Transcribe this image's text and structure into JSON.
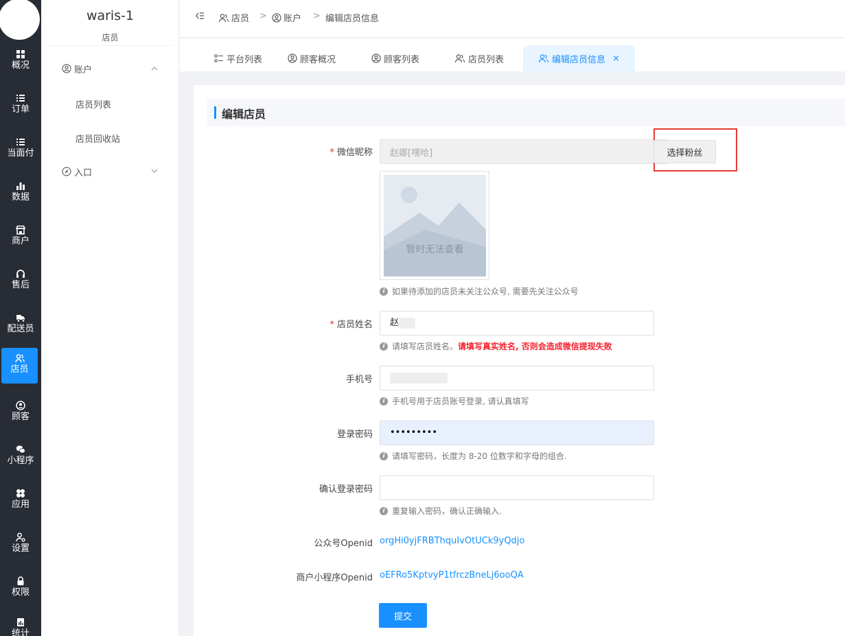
{
  "nav": {
    "items": [
      {
        "key": "overview",
        "label": "概况",
        "icon": "grid-icon"
      },
      {
        "key": "orders",
        "label": "订单",
        "icon": "list-icon"
      },
      {
        "key": "facepay",
        "label": "当面付",
        "icon": "list-icon"
      },
      {
        "key": "data",
        "label": "数据",
        "icon": "bar-chart-icon"
      },
      {
        "key": "merchant",
        "label": "商户",
        "icon": "store-icon"
      },
      {
        "key": "aftersale",
        "label": "售后",
        "icon": "headset-icon"
      },
      {
        "key": "delivery",
        "label": "配送员",
        "icon": "truck-icon"
      },
      {
        "key": "staff",
        "label": "店员",
        "icon": "users-icon",
        "active": true
      },
      {
        "key": "customer",
        "label": "顾客",
        "icon": "user-circle-icon"
      },
      {
        "key": "miniapp",
        "label": "小程序",
        "icon": "wechat-icon"
      },
      {
        "key": "apps",
        "label": "应用",
        "icon": "clover-icon"
      },
      {
        "key": "settings",
        "label": "设置",
        "icon": "user-gear-icon"
      },
      {
        "key": "permission",
        "label": "权限",
        "icon": "lock-icon"
      },
      {
        "key": "stats",
        "label": "统计",
        "icon": "report-icon"
      }
    ]
  },
  "subnav": {
    "shop_name": "waris-1",
    "shop_role": "店员",
    "account_group": "账户",
    "links": [
      "店员列表",
      "店员回收站"
    ],
    "entry_group": "入口"
  },
  "breadcrumb": [
    "店员",
    "账户",
    "编辑店员信息"
  ],
  "tabs": [
    {
      "label": "平台列表",
      "icon": "list-icon"
    },
    {
      "label": "顾客概况",
      "icon": "user-circle-icon"
    },
    {
      "label": "顾客列表",
      "icon": "user-circle-icon"
    },
    {
      "label": "店员列表",
      "icon": "users-icon"
    },
    {
      "label": "编辑店员信息",
      "icon": "users-icon",
      "active": true,
      "close": "×"
    }
  ],
  "form": {
    "title": "编辑店员",
    "nickname": {
      "label": "微信昵称",
      "value": "赵娜[嘿哈]",
      "button": "选择粉丝"
    },
    "avatar_placeholder": "暂时无法查看",
    "nickname_tip": "如果待添加的店员未关注公众号, 需要先关注公众号",
    "name": {
      "label": "店员姓名",
      "value": "赵",
      "tip": "请填写店员姓名。",
      "warn": "请填写真实姓名, 否则会造成微信提现失败"
    },
    "phone": {
      "label": "手机号",
      "value": "",
      "tip": "手机号用于店员账号登录, 请认真填写"
    },
    "password": {
      "label": "登录密码",
      "value": "•••••••••",
      "tip": "请填写密码，长度为 8-20 位数字和字母的组合."
    },
    "confirm": {
      "label": "确认登录密码",
      "value": "",
      "tip": "重复输入密码，确认正确输入."
    },
    "mp_openid": {
      "label": "公众号Openid",
      "value": "orgHi0yjFRBThquIvOtUCk9yQdjo"
    },
    "mini_openid": {
      "label": "商户小程序Openid",
      "value": "oEFRo5KptvyP1tfrczBneLj6ooQA"
    },
    "submit": "提交"
  }
}
